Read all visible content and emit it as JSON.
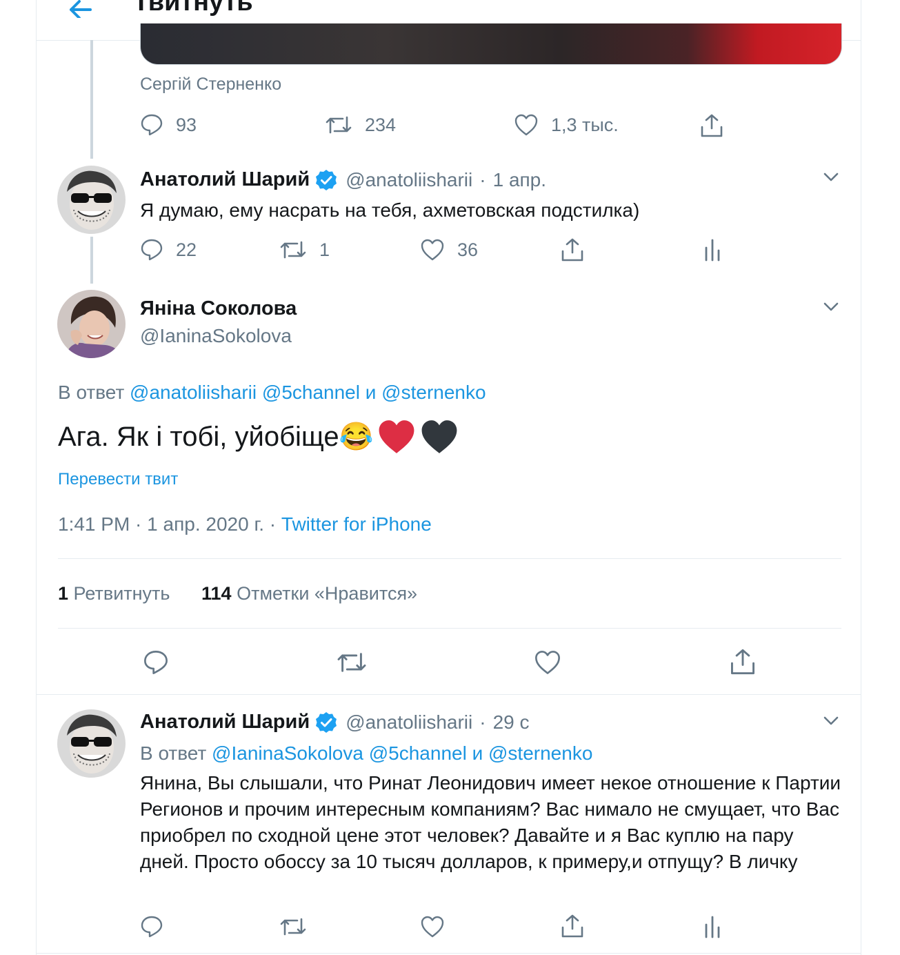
{
  "header": {
    "title": "Твитнуть"
  },
  "prev_tweet": {
    "media_caption": "Сергій Стерненко",
    "replies": "93",
    "retweets": "234",
    "likes": "1,3 тыс."
  },
  "reply1": {
    "author_name": "Анатолий Шарий",
    "handle": "@anatoliisharii",
    "dot": "·",
    "time": "1 апр.",
    "text": "Я думаю, ему насрать на тебя, ахметовская подстилка)",
    "replies": "22",
    "retweets": "1",
    "likes": "36"
  },
  "main": {
    "author_name": "Яніна Соколова",
    "handle": "@IaninaSokolova",
    "reply_prefix": "В ответ",
    "reply_to": "@anatoliisharii @5channel и @sternenko",
    "text": "Ага. Як і тобі, уйобіще",
    "emoji": "😂",
    "translate": "Перевести твит",
    "timestamp": "1:41 PM · 1 апр. 2020 г. · ",
    "source": "Twitter for iPhone",
    "retweet_count": "1",
    "retweet_label": "Ретвитнуть",
    "like_count": "114",
    "like_label": "Отметки «Нравится»"
  },
  "reply2": {
    "author_name": "Анатолий Шарий",
    "handle": "@anatoliisharii",
    "dot": "·",
    "time": "29 с",
    "reply_prefix": "В ответ",
    "reply_to": "@IaninaSokolova @5channel и @sternenko",
    "text": "Янина, Вы слышали, что Ринат Леонидович имеет некое отношение к Партии Регионов и прочим интересным компаниям? Вас нимало не смущает, что Вас приобрел по сходной цене этот человек? Давайте и я Вас куплю на пару дней. Просто обоссу за 10 тысяч долларов, к примеру,и отпущу? В личку"
  },
  "colors": {
    "accent": "#1b95e0",
    "muted": "#657786",
    "border": "#e6ecf0",
    "verified": "#1da1f2",
    "heart_red": "#dd2e44",
    "heart_black": "#31373d"
  },
  "icons": [
    "back-arrow-icon",
    "reply-icon",
    "retweet-icon",
    "like-icon",
    "share-icon",
    "analytics-icon",
    "verified-badge-icon",
    "chevron-down-icon"
  ]
}
